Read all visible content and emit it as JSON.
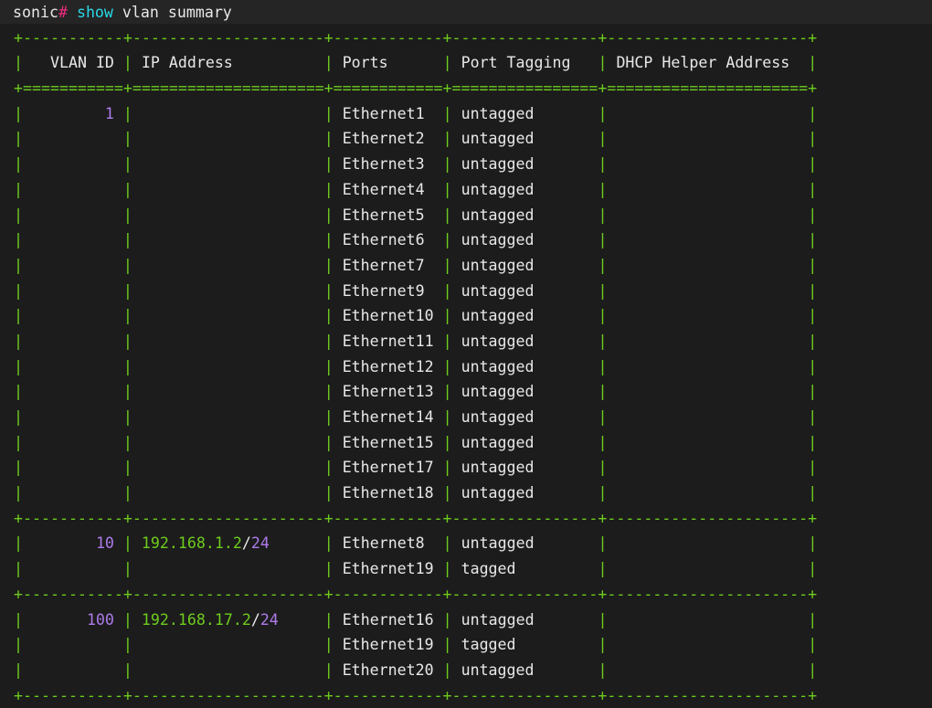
{
  "terminal": {
    "background": "#1c1c1c",
    "prompt_band_background": "#252525",
    "colors": {
      "border_green": "#6ecc1e",
      "text_white": "#e8e8e8",
      "vlan_purple": "#ad7bea",
      "command_cyan": "#29d8e8",
      "prompt_hash_magenta": "#ef2a7e"
    },
    "prompt": {
      "host": "sonic",
      "symbol": "#",
      "command_keyword": "show",
      "command_args": " vlan summary",
      "full_command": "sonic# show vlan summary"
    }
  },
  "table": {
    "columns": [
      {
        "name": "VLAN ID",
        "width": 11,
        "align": "right"
      },
      {
        "name": "IP Address",
        "width": 21,
        "align": "left"
      },
      {
        "name": "Ports",
        "width": 12,
        "align": "left"
      },
      {
        "name": "Port Tagging",
        "width": 16,
        "align": "left"
      },
      {
        "name": "DHCP Helper Address",
        "width": 22,
        "align": "left"
      }
    ],
    "border_chars": {
      "corner": "+",
      "top": "-",
      "header_sep": "=",
      "vertical": "|"
    },
    "groups": [
      {
        "vlan_id": "1",
        "ip_address": "",
        "ip_network": "",
        "ip_prefix": "",
        "dhcp_helper_address": "",
        "rows": [
          {
            "port": "Ethernet1",
            "tagging": "untagged"
          },
          {
            "port": "Ethernet2",
            "tagging": "untagged"
          },
          {
            "port": "Ethernet3",
            "tagging": "untagged"
          },
          {
            "port": "Ethernet4",
            "tagging": "untagged"
          },
          {
            "port": "Ethernet5",
            "tagging": "untagged"
          },
          {
            "port": "Ethernet6",
            "tagging": "untagged"
          },
          {
            "port": "Ethernet7",
            "tagging": "untagged"
          },
          {
            "port": "Ethernet9",
            "tagging": "untagged"
          },
          {
            "port": "Ethernet10",
            "tagging": "untagged"
          },
          {
            "port": "Ethernet11",
            "tagging": "untagged"
          },
          {
            "port": "Ethernet12",
            "tagging": "untagged"
          },
          {
            "port": "Ethernet13",
            "tagging": "untagged"
          },
          {
            "port": "Ethernet14",
            "tagging": "untagged"
          },
          {
            "port": "Ethernet15",
            "tagging": "untagged"
          },
          {
            "port": "Ethernet17",
            "tagging": "untagged"
          },
          {
            "port": "Ethernet18",
            "tagging": "untagged"
          }
        ]
      },
      {
        "vlan_id": "10",
        "ip_address": "192.168.1.2/24",
        "ip_network": "192.168.1.2",
        "ip_prefix": "24",
        "dhcp_helper_address": "",
        "rows": [
          {
            "port": "Ethernet8",
            "tagging": "untagged"
          },
          {
            "port": "Ethernet19",
            "tagging": "tagged"
          }
        ]
      },
      {
        "vlan_id": "100",
        "ip_address": "192.168.17.2/24",
        "ip_network": "192.168.17.2",
        "ip_prefix": "24",
        "dhcp_helper_address": "",
        "rows": [
          {
            "port": "Ethernet16",
            "tagging": "untagged"
          },
          {
            "port": "Ethernet19",
            "tagging": "tagged"
          },
          {
            "port": "Ethernet20",
            "tagging": "untagged"
          }
        ]
      }
    ]
  }
}
